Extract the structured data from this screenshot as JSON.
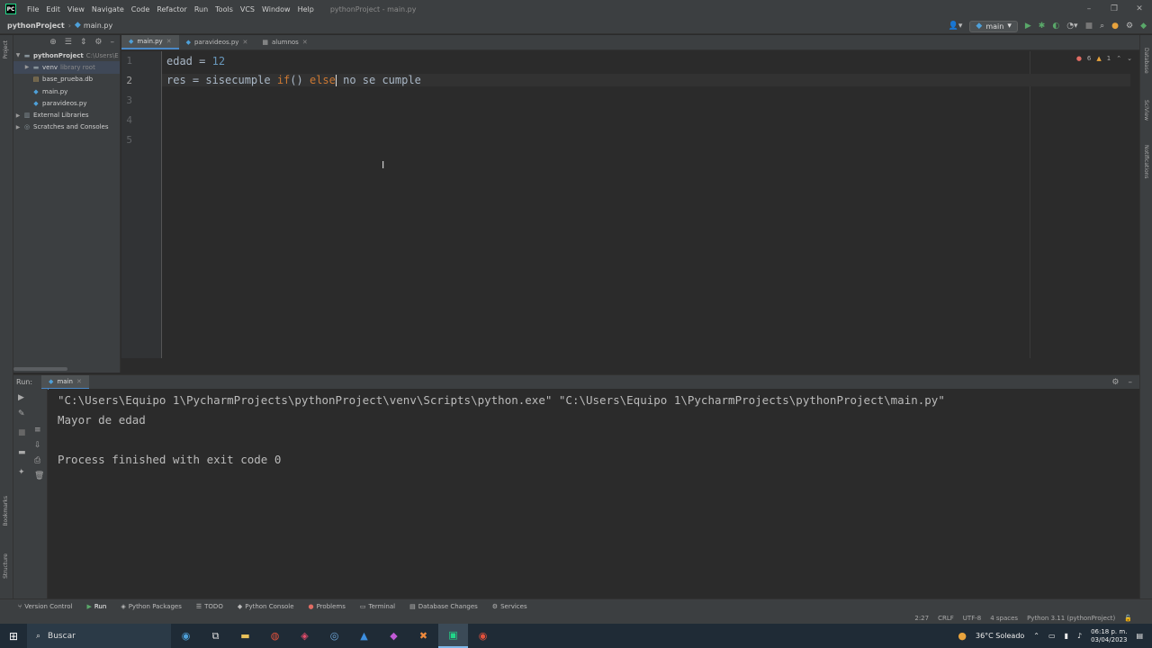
{
  "menubar": {
    "items": [
      "File",
      "Edit",
      "View",
      "Navigate",
      "Code",
      "Refactor",
      "Run",
      "Tools",
      "VCS",
      "Window",
      "Help"
    ],
    "window_title": "pythonProject - main.py"
  },
  "navbar": {
    "project": "pythonProject",
    "file": "main.py",
    "run_config": "main"
  },
  "left_strip": {
    "project_label": "Project",
    "bookmarks_label": "Bookmarks",
    "structure_label": "Structure"
  },
  "right_strip": {
    "database_label": "Database",
    "sciview_label": "SciView",
    "notifications_label": "Notifications"
  },
  "project_tree": {
    "root": "pythonProject",
    "root_path": "C:\\Users\\E",
    "venv": "venv",
    "venv_note": "library root",
    "files": [
      "base_prueba.db",
      "main.py",
      "paravideos.py"
    ],
    "external": "External Libraries",
    "scratches": "Scratches and Consoles"
  },
  "tabs": [
    {
      "label": "main.py",
      "active": true
    },
    {
      "label": "paravideos.py",
      "active": false
    },
    {
      "label": "alumnos",
      "active": false
    }
  ],
  "editor": {
    "line_numbers": [
      "1",
      "2",
      "3",
      "4",
      "5"
    ],
    "line1": {
      "var": "edad",
      "op": " = ",
      "num": "12"
    },
    "line2": {
      "a": "res = sisecumple ",
      "kw_if": "if",
      "b": "() ",
      "kw_else": "else",
      "c": " no se cumple"
    },
    "errors": "6",
    "warnings": "1"
  },
  "run_panel": {
    "label": "Run:",
    "tab": "main",
    "output": [
      "\"C:\\Users\\Equipo 1\\PycharmProjects\\pythonProject\\venv\\Scripts\\python.exe\" \"C:\\Users\\Equipo 1\\PycharmProjects\\pythonProject\\main.py\"",
      "Mayor de edad",
      "",
      "Process finished with exit code 0"
    ]
  },
  "tool_windows": [
    "Version Control",
    "Run",
    "Python Packages",
    "TODO",
    "Python Console",
    "Problems",
    "Terminal",
    "Database Changes",
    "Services"
  ],
  "statusbar": {
    "position": "2:27",
    "line_sep": "CRLF",
    "encoding": "UTF-8",
    "indent": "4 spaces",
    "interpreter": "Python 3.11 (pythonProject)"
  },
  "taskbar": {
    "search": "Buscar",
    "weather": "36°C  Soleado",
    "time": "06:18 p. m.",
    "date": "03/04/2023"
  }
}
